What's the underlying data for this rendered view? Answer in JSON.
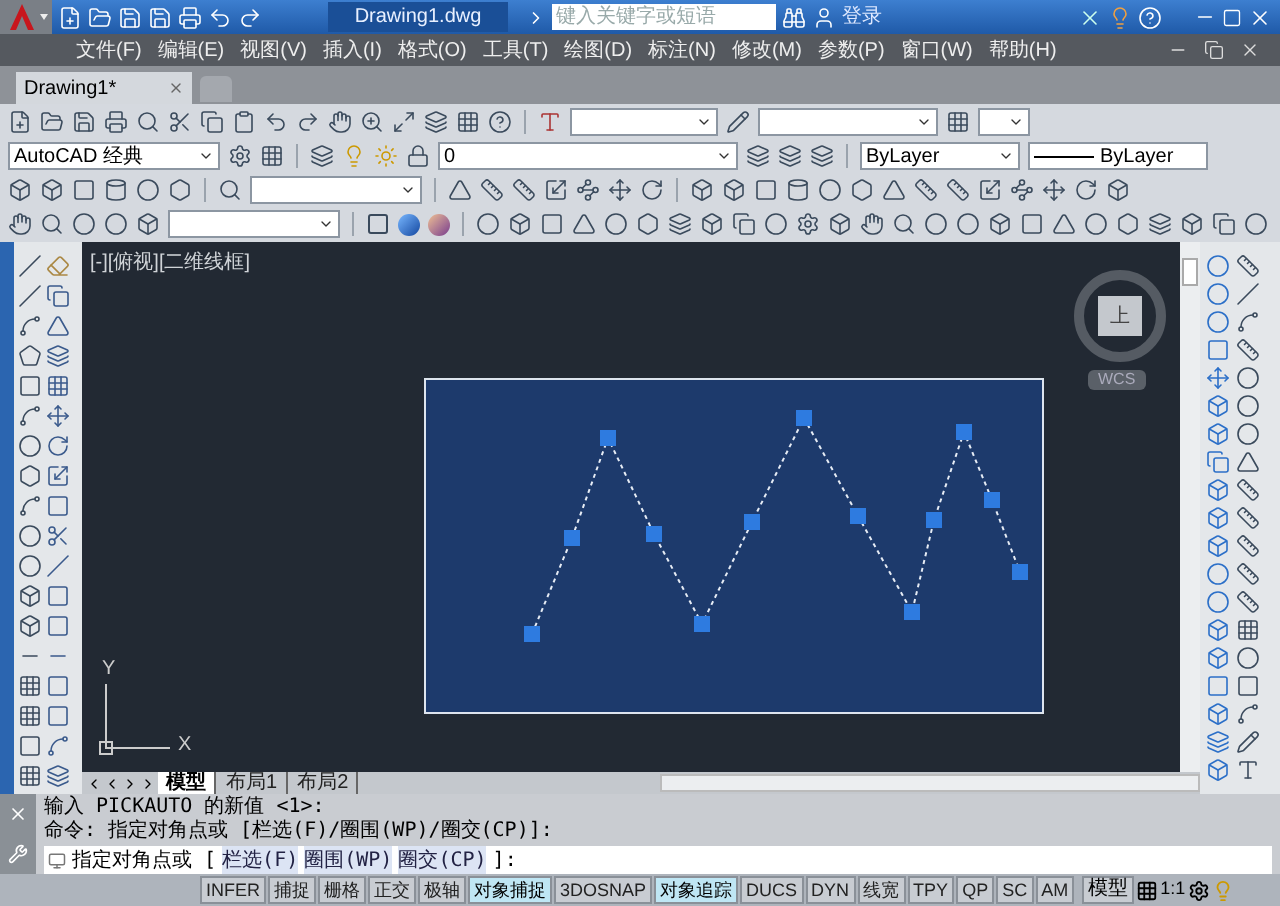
{
  "title_bar": {
    "title": "Drawing1.dwg",
    "search": {
      "placeholder": "键入关键字或短语"
    },
    "sign_in": "登录"
  },
  "menu_bar": {
    "items": [
      "文件(F)",
      "编辑(E)",
      "视图(V)",
      "插入(I)",
      "格式(O)",
      "工具(T)",
      "绘图(D)",
      "标注(N)",
      "修改(M)",
      "参数(P)",
      "窗口(W)",
      "帮助(H)"
    ]
  },
  "document_tabs": [
    {
      "label": "Drawing1*",
      "selected": true
    }
  ],
  "toolbars": {
    "workspace": "AutoCAD 经典",
    "layer": "0",
    "color_control": "ByLayer",
    "linetype": "ByLayer"
  },
  "viewport": {
    "label": "[-][俯视][二维线框]",
    "view_cube": {
      "face": "上",
      "coordinate_system": "WCS"
    },
    "ucs": {
      "x": "X",
      "y": "Y"
    }
  },
  "layout_tabs": [
    {
      "label": "模型",
      "selected": true
    },
    {
      "label": "布局1",
      "selected": false
    },
    {
      "label": "布局2",
      "selected": false
    }
  ],
  "command_history": [
    "输入 PICKAUTO 的新值 <1>:",
    "命令: 指定对角点或 [栏选(F)/圈围(WP)/圈交(CP)]:"
  ],
  "command_prompt": {
    "text": "指定对角点或 [",
    "options": [
      "栏选(F)",
      "圈围(WP)",
      "圈交(CP)"
    ],
    "end": "]:"
  },
  "status_bar": {
    "toggles": [
      {
        "label": "INFER",
        "on": false
      },
      {
        "label": "捕捉",
        "on": false
      },
      {
        "label": "栅格",
        "on": false
      },
      {
        "label": "正交",
        "on": false
      },
      {
        "label": "极轴",
        "on": false
      },
      {
        "label": "对象捕捉",
        "on": true
      },
      {
        "label": "3DOSNAP",
        "on": false
      },
      {
        "label": "对象追踪",
        "on": true
      },
      {
        "label": "DUCS",
        "on": false
      },
      {
        "label": "DYN",
        "on": false
      },
      {
        "label": "线宽",
        "on": false
      },
      {
        "label": "TPY",
        "on": false
      },
      {
        "label": "QP",
        "on": false
      },
      {
        "label": "SC",
        "on": false
      },
      {
        "label": "AM",
        "on": false
      }
    ],
    "model": "模型",
    "scale": "1:1"
  }
}
